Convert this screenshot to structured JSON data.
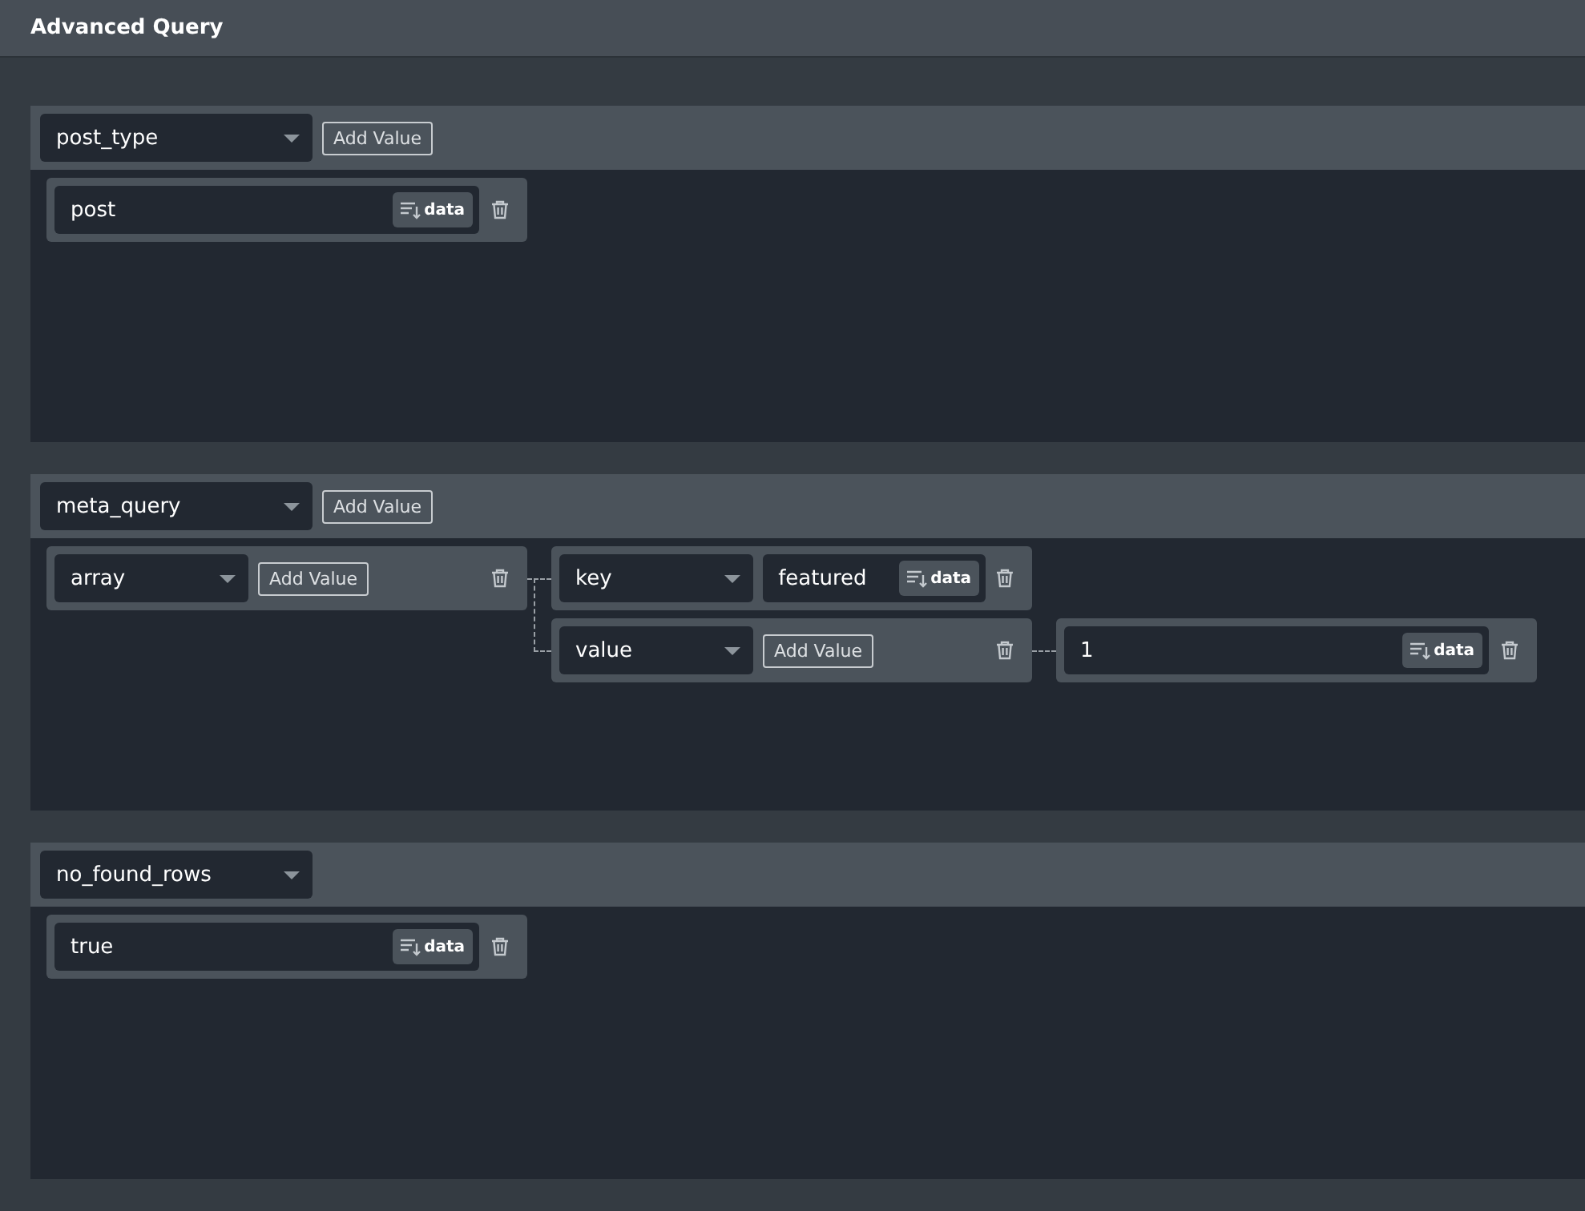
{
  "header": {
    "title": "Advanced Query"
  },
  "sections": [
    {
      "key": "post_type",
      "add_button": "Add Value",
      "values": [
        {
          "kind": "text",
          "value": "post",
          "data_button": "data"
        }
      ]
    },
    {
      "key": "meta_query",
      "add_button": "Add Value",
      "values": [
        {
          "kind": "array",
          "type": "array",
          "add_button": "Add Value",
          "children": [
            {
              "kind": "pair",
              "key": "key",
              "value": "featured",
              "data_button": "data"
            },
            {
              "kind": "array",
              "type": "value",
              "add_button": "Add Value",
              "children": [
                {
                  "kind": "text",
                  "value": "1",
                  "data_button": "data"
                }
              ]
            }
          ]
        }
      ]
    },
    {
      "key": "no_found_rows",
      "values": [
        {
          "kind": "text",
          "value": "true",
          "data_button": "data"
        }
      ]
    }
  ]
}
